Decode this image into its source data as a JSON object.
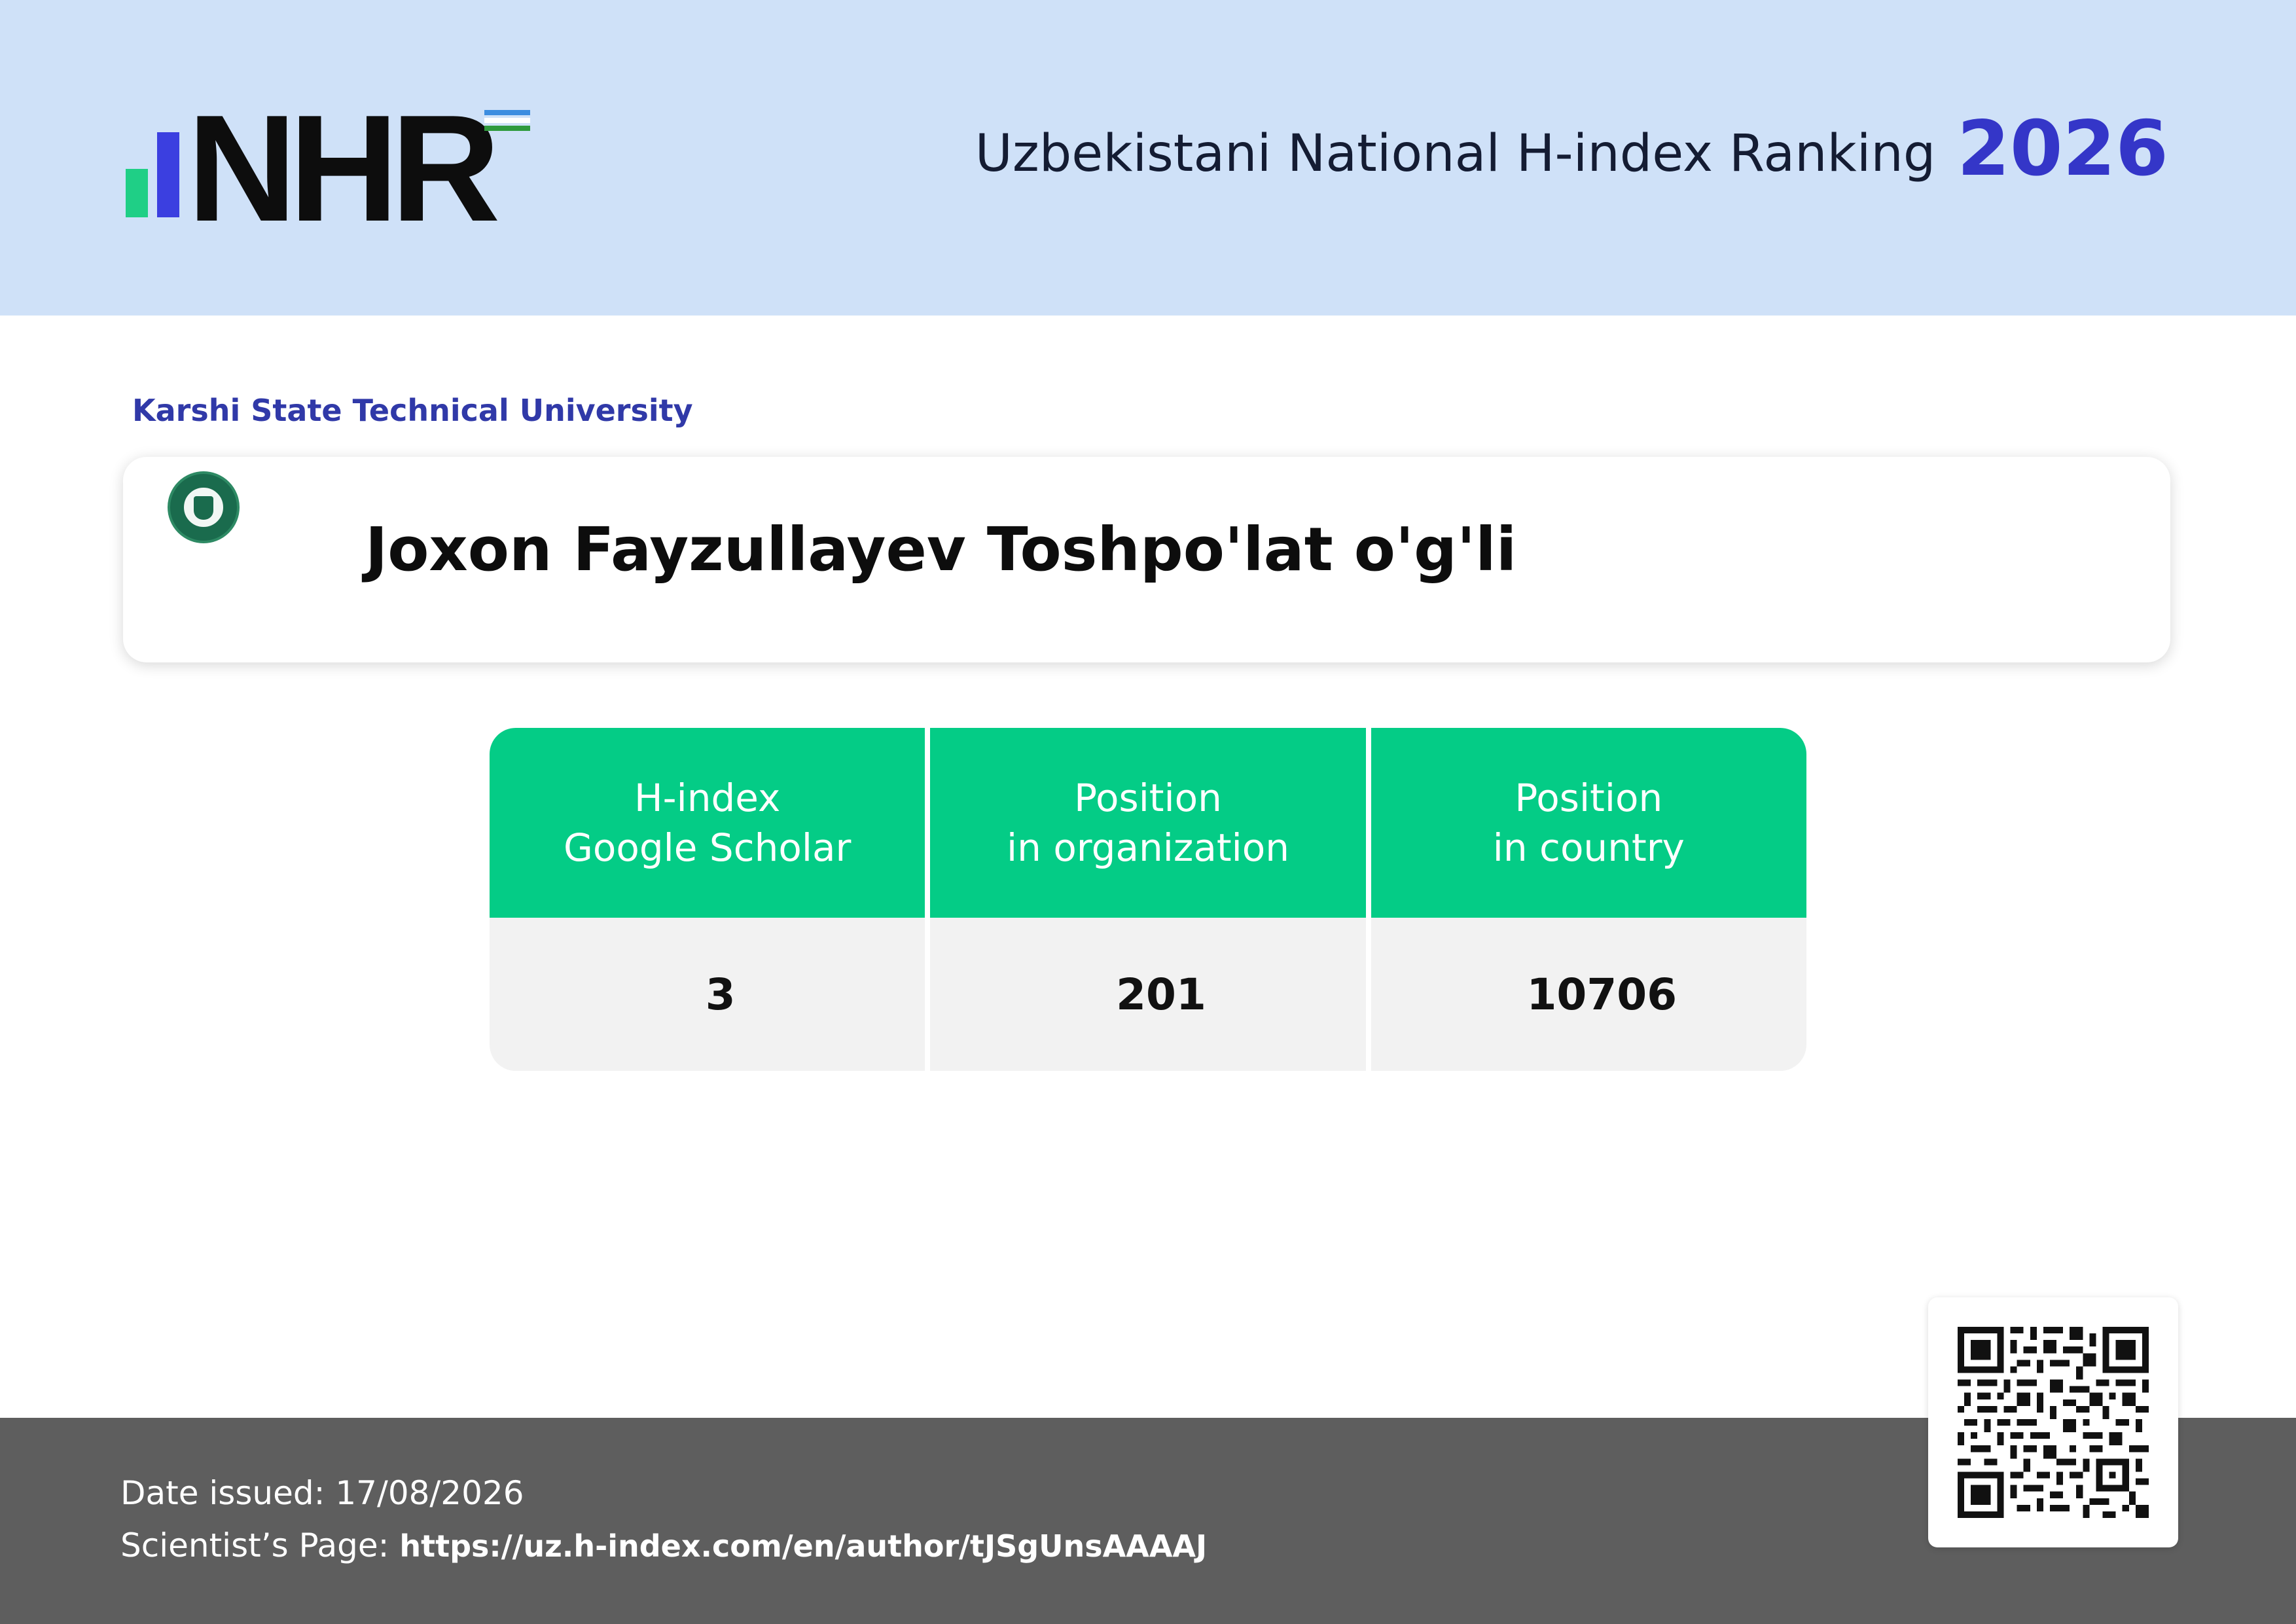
{
  "header": {
    "logo_text": "NHR",
    "title": "Uzbekistani National H-index Ranking",
    "year": "2026",
    "colors": {
      "band": "#cfe1f8",
      "accent": "#3436c8",
      "bar_green": "#1fcf86",
      "bar_blue": "#3b3fe0"
    }
  },
  "organization": "Karshi State Technical University",
  "scientist": {
    "name": "Joxon Fayzullayev Toshpo'lat o'g'li",
    "seal_icon": "university-seal-icon"
  },
  "stats": {
    "columns": [
      {
        "header_lines": [
          "H-index",
          "Google Scholar"
        ],
        "value": "3"
      },
      {
        "header_lines": [
          "Position",
          "in organization"
        ],
        "value": "201"
      },
      {
        "header_lines": [
          "Position",
          "in country"
        ],
        "value": "10706"
      }
    ],
    "colors": {
      "header_bg": "#04cc86",
      "cell_bg": "#f2f2f2"
    }
  },
  "footer": {
    "date_label": "Date issued:",
    "date_value": "17/08/2026",
    "page_label": "Scientist’s Page:",
    "page_url": "https://uz.h-index.com/en/author/tJSgUnsAAAAJ",
    "qr_icon": "qr-code-icon"
  }
}
